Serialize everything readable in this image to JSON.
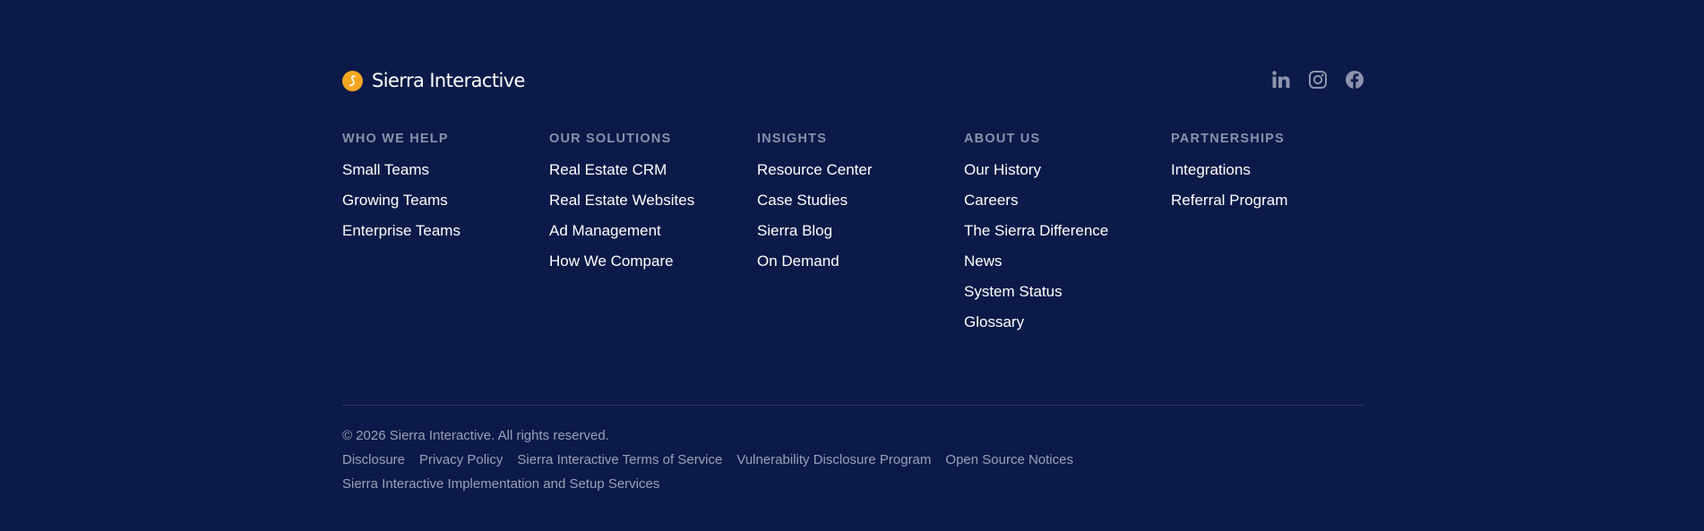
{
  "brand": {
    "name": "Sierra Interactive",
    "logo_letter": "S",
    "accent_color": "#f5a623",
    "background_color": "#0b1a48"
  },
  "social": [
    {
      "label": "LinkedIn",
      "icon": "linkedin-icon"
    },
    {
      "label": "Instagram",
      "icon": "instagram-icon"
    },
    {
      "label": "Facebook",
      "icon": "facebook-icon"
    }
  ],
  "columns": [
    {
      "heading": "WHO WE HELP",
      "links": [
        "Small Teams",
        "Growing Teams",
        "Enterprise Teams"
      ]
    },
    {
      "heading": "OUR SOLUTIONS",
      "links": [
        "Real Estate CRM",
        "Real Estate Websites",
        "Ad Management",
        "How We Compare"
      ]
    },
    {
      "heading": "INSIGHTS",
      "links": [
        "Resource Center",
        "Case Studies",
        "Sierra Blog",
        "On Demand"
      ]
    },
    {
      "heading": "ABOUT US",
      "links": [
        "Our History",
        "Careers",
        "The Sierra Difference",
        "News",
        "System Status",
        "Glossary"
      ]
    },
    {
      "heading": "PARTNERSHIPS",
      "links": [
        "Integrations",
        "Referral Program"
      ]
    }
  ],
  "legal": {
    "copyright": "© 2026 Sierra Interactive. All rights reserved.",
    "links": [
      "Disclosure",
      "Privacy Policy",
      "Sierra Interactive Terms of Service",
      "Vulnerability Disclosure Program",
      "Open Source Notices",
      "Sierra Interactive Implementation and Setup Services"
    ]
  }
}
